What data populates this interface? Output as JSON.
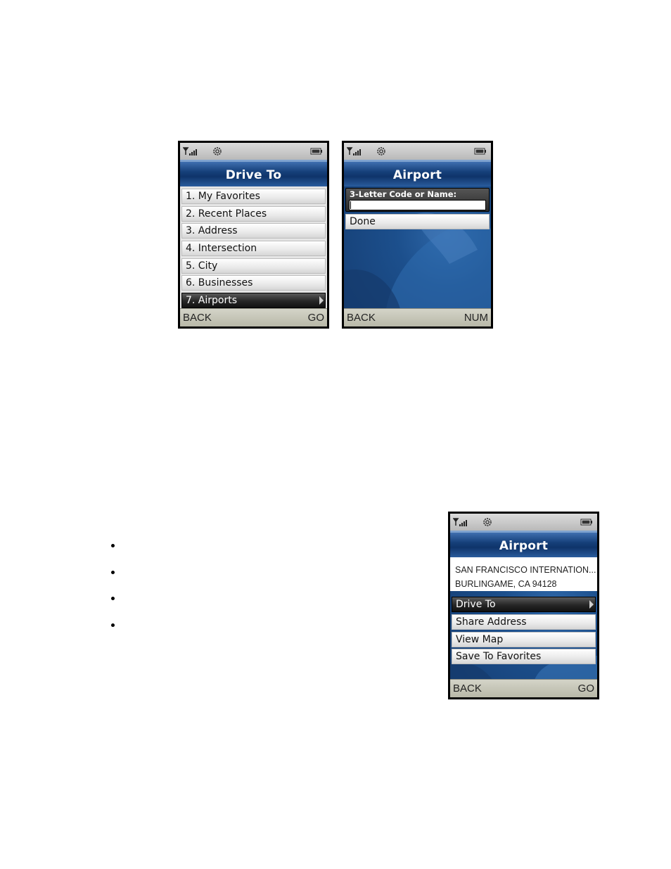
{
  "screens": {
    "drive_to": {
      "title": "Drive To",
      "items": [
        "1. My Favorites",
        "2. Recent Places",
        "3. Address",
        "4. Intersection",
        "5. City",
        "6. Businesses",
        "7. Airports"
      ],
      "selected_item": "7. Airports",
      "softkeys": {
        "left": "BACK",
        "right": "GO"
      }
    },
    "airport_search": {
      "title": "Airport",
      "field_label": "3-Letter Code or Name:",
      "field_value": "",
      "done_label": "Done",
      "softkeys": {
        "left": "BACK",
        "right": "NUM"
      }
    },
    "airport_detail": {
      "title": "Airport",
      "name": "SAN FRANCISCO INTERNATION...",
      "address": "BURLINGAME, CA 94128",
      "actions": [
        "Drive To",
        "Share Address",
        "View Map",
        "Save To Favorites"
      ],
      "selected_action": "Drive To",
      "softkeys": {
        "left": "BACK",
        "right": "GO"
      }
    }
  },
  "colors": {
    "title_bar": "#16407a",
    "selected_item": "#262626",
    "background": "#1c4f8c"
  }
}
